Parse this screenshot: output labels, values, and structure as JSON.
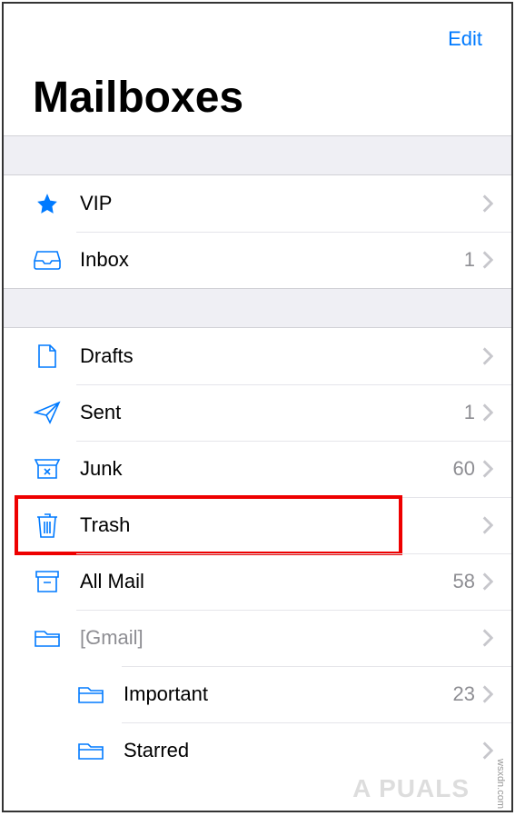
{
  "header": {
    "edit_label": "Edit",
    "title": "Mailboxes"
  },
  "section1": [
    {
      "icon": "star-icon",
      "label": "VIP",
      "count": "",
      "highlighted": false
    },
    {
      "icon": "inbox-icon",
      "label": "Inbox",
      "count": "1",
      "highlighted": false
    }
  ],
  "section2": [
    {
      "icon": "drafts-icon",
      "label": "Drafts",
      "count": "",
      "highlighted": false,
      "indent": false
    },
    {
      "icon": "sent-icon",
      "label": "Sent",
      "count": "1",
      "highlighted": false,
      "indent": false
    },
    {
      "icon": "junk-icon",
      "label": "Junk",
      "count": "60",
      "highlighted": false,
      "indent": false
    },
    {
      "icon": "trash-icon",
      "label": "Trash",
      "count": "",
      "highlighted": true,
      "indent": false
    },
    {
      "icon": "archive-icon",
      "label": "All Mail",
      "count": "58",
      "highlighted": false,
      "indent": false
    },
    {
      "icon": "folder-icon",
      "label": "[Gmail]",
      "count": "",
      "highlighted": false,
      "indent": false,
      "gray": true
    },
    {
      "icon": "folder-icon",
      "label": "Important",
      "count": "23",
      "highlighted": false,
      "indent": true
    },
    {
      "icon": "folder-icon",
      "label": "Starred",
      "count": "",
      "highlighted": false,
      "indent": true
    }
  ],
  "watermark_side": "wsxdn.com",
  "watermark_brand": "A  PUALS"
}
